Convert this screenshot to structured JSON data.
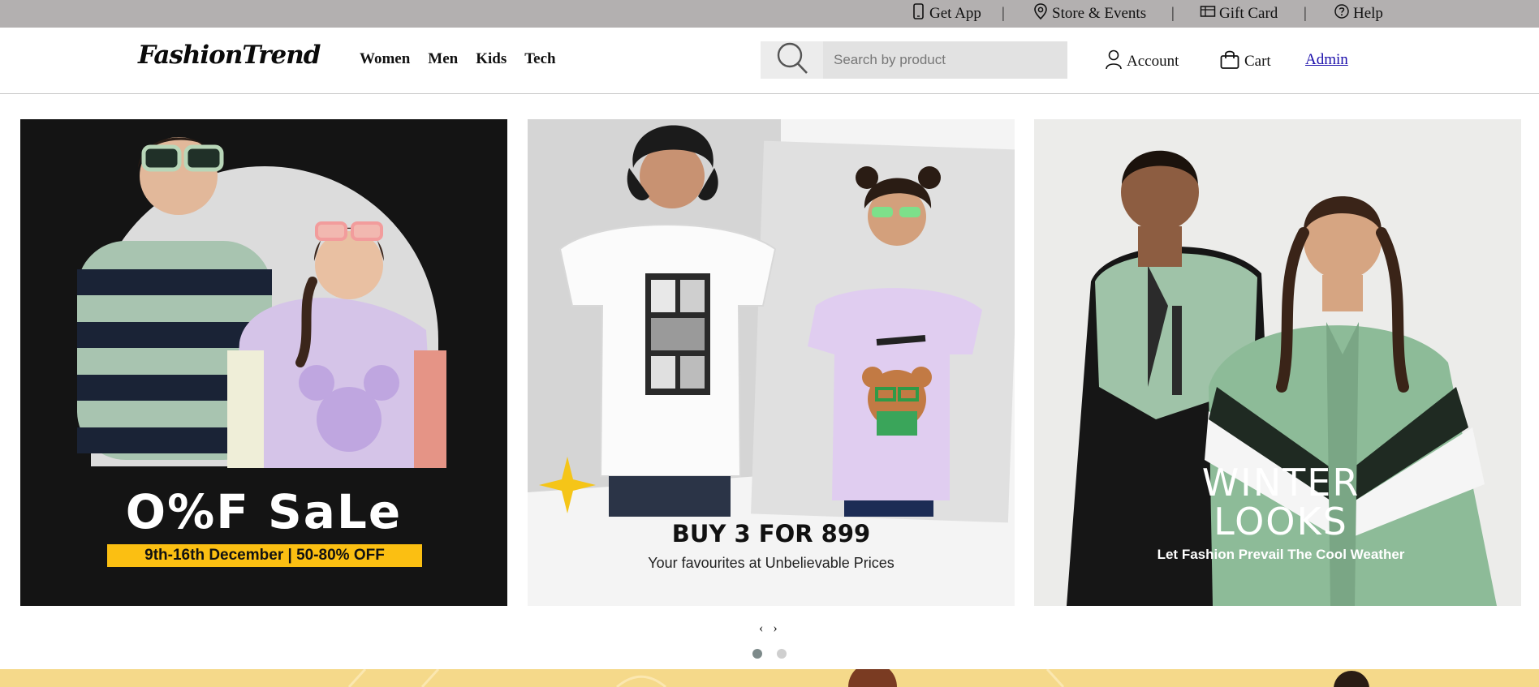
{
  "topbar": {
    "get_app": "Get App",
    "store_events": "Store & Events",
    "gift_card": "Gift Card",
    "help": "Help",
    "separator": "|"
  },
  "header": {
    "logo": "FashionTrend",
    "nav": [
      "Women",
      "Men",
      "Kids",
      "Tech"
    ],
    "search_placeholder": "Search by product",
    "account": "Account",
    "cart": "Cart",
    "admin": "Admin"
  },
  "banners": [
    {
      "title": "O%F SaLe",
      "strip": "9th-16th December  |  50-80% OFF"
    },
    {
      "title": "BUY 3 FOR 899",
      "subtitle": "Your favourites at Unbelievable Prices"
    },
    {
      "title_line1": "WINTER",
      "title_line2": "LOOKS",
      "subtitle": "Let Fashion Prevail The Cool Weather"
    }
  ],
  "carousel": {
    "prev": "‹",
    "next": "›",
    "active_dot": 1,
    "dot_count": 2
  },
  "colors": {
    "topbar_bg": "#b3b0b0",
    "sale_yellow": "#fbbf12",
    "link_blue": "#1a0dab",
    "dot_active": "#7d8a8a",
    "dot_inactive": "#cfcfcf",
    "strip_bg": "#f5d98a"
  }
}
